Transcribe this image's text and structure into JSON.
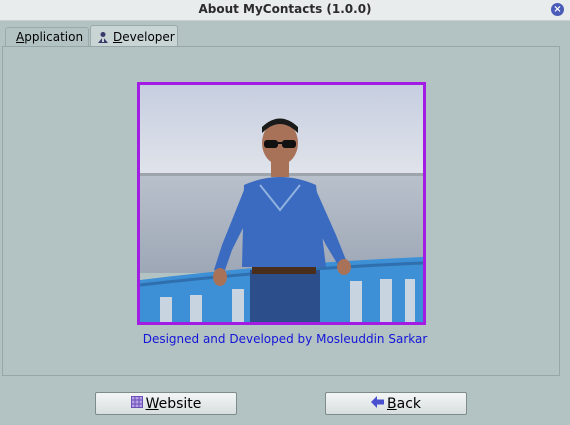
{
  "window": {
    "title": "About MyContacts (1.0.0)",
    "close_icon": "close-icon"
  },
  "tabs": [
    {
      "mnemonic": "A",
      "rest": "pplication",
      "icon": "red-circle-icon",
      "selected": false
    },
    {
      "mnemonic": "D",
      "rest": "eveloper",
      "icon": "developer-icon",
      "selected": true
    }
  ],
  "developer": {
    "photo_alt": "developer photo",
    "caption": "Designed and Developed by Mosleuddin Sarkar"
  },
  "buttons": {
    "website": {
      "mnemonic": "W",
      "rest": "ebsite",
      "icon": "grid-icon"
    },
    "back": {
      "mnemonic": "B",
      "rest": "ack",
      "icon": "arrow-left-icon"
    }
  },
  "colors": {
    "background": "#b3c3c3",
    "photo_border": "#a21ce3",
    "caption_text": "#1414d8"
  }
}
